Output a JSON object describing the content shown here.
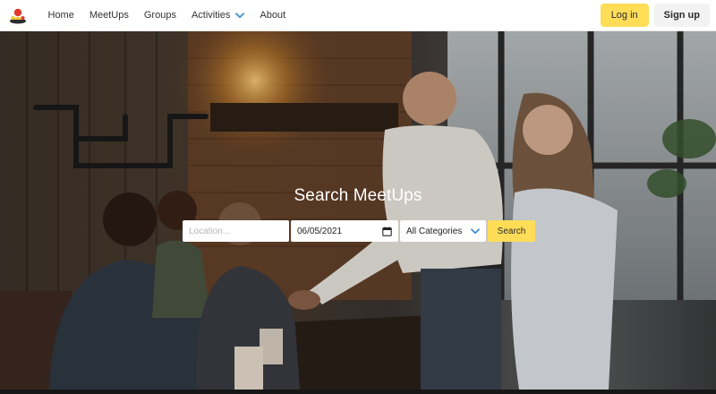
{
  "brand": {
    "logo_icon": "meetup-logo-icon"
  },
  "nav": {
    "items": [
      {
        "label": "Home"
      },
      {
        "label": "MeetUps"
      },
      {
        "label": "Groups"
      },
      {
        "label": "Activities",
        "icon": "chevron-down-icon"
      },
      {
        "label": "About"
      }
    ],
    "login_label": "Log in",
    "signup_label": "Sign up"
  },
  "hero": {
    "title": "Search MeetUps",
    "location_placeholder": "Location...",
    "date_value": "06/05/2021",
    "category_value": "All Categories",
    "search_label": "Search"
  },
  "colors": {
    "accent": "#ffdd57",
    "chevron": "#3e8ed0",
    "signup_bg": "#f2f2f2"
  }
}
